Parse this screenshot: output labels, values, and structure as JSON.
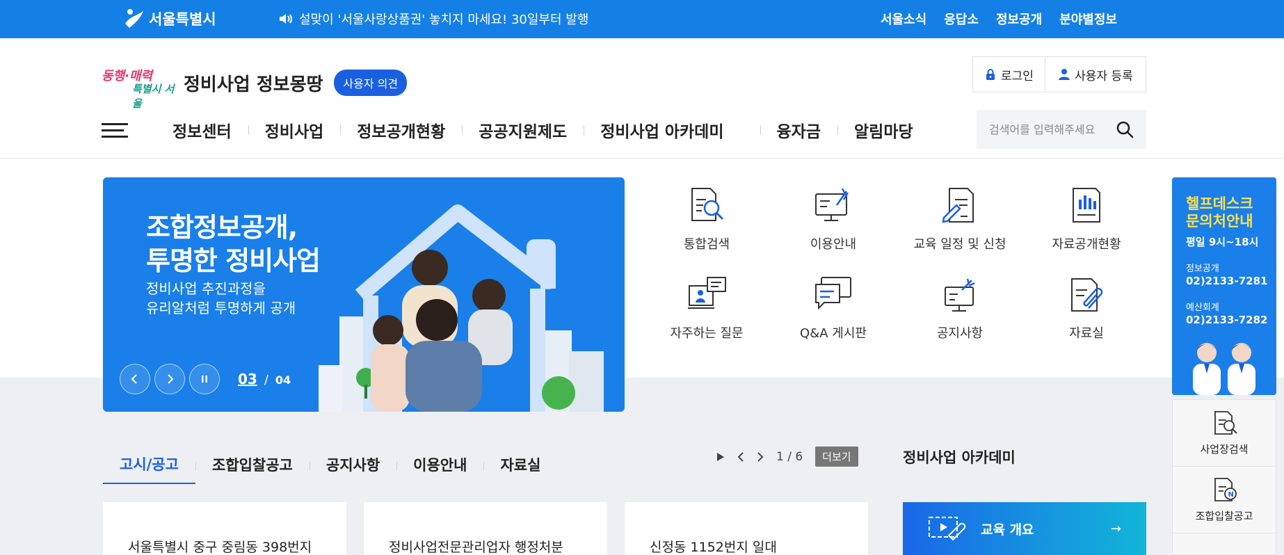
{
  "topbar": {
    "logo_text": "서울특별시",
    "notice": "설맞이 '서울사랑상품권' 놓치지 마세요! 30일부터 발행",
    "links": [
      "서울소식",
      "응답소",
      "정보공개",
      "분야별정보"
    ]
  },
  "header": {
    "brand_slogan_1": "동행·매력",
    "brand_slogan_2": "특별시 서울",
    "site_title": "정비사업 정보몽땅",
    "opinion_label": "사용자 의견",
    "login_label": "로그인",
    "register_label": "사용자 등록",
    "menu": [
      "정보센터",
      "정비사업",
      "정보공개현황",
      "공공지원제도",
      "정비사업 아카데미",
      "융자금",
      "알림마당"
    ],
    "search_placeholder": "검색어를 입력해주세요"
  },
  "banner": {
    "headline_1": "조합정보공개,",
    "headline_2": "투명한 정비사업",
    "sub_1": "정비사업 추진과정을",
    "sub_2": "유리알처럼 투명하게 공개",
    "current": "03",
    "separator": "/",
    "total": "04"
  },
  "quick_links": [
    {
      "label": "통합검색",
      "icon": "search-document-icon"
    },
    {
      "label": "이용안내",
      "icon": "monitor-guide-icon"
    },
    {
      "label": "교육 일정 및 신청",
      "icon": "edit-document-icon"
    },
    {
      "label": "자료공개현황",
      "icon": "chart-document-icon"
    },
    {
      "label": "자주하는 질문",
      "icon": "faq-monitor-icon"
    },
    {
      "label": "Q&A 게시판",
      "icon": "chat-bubbles-icon"
    },
    {
      "label": "공지사항",
      "icon": "announcement-icon"
    },
    {
      "label": "자료실",
      "icon": "attachment-document-icon"
    }
  ],
  "helpdesk": {
    "title_1": "헬프데스크",
    "title_2": "문의처안내",
    "hours": "평일 9시~18시",
    "info_label": "정보공개",
    "info_number": "02)2133-7281",
    "budget_label": "예산회계",
    "budget_number": "02)2133-7282"
  },
  "side_quick": [
    {
      "label": "사업장검색",
      "icon": "site-search-icon"
    },
    {
      "label": "조합입찰공고",
      "icon": "bid-notice-icon"
    }
  ],
  "board": {
    "tabs": [
      "고시/공고",
      "조합입찰공고",
      "공지사항",
      "이용안내",
      "자료실"
    ],
    "page": "1 / 6",
    "more_label": "더보기",
    "cards": [
      "서울특별시 중구 중림동 398번지",
      "정비사업전문관리업자 행정처분",
      "신정동 1152번지 일대"
    ]
  },
  "academy": {
    "title": "정비사업 아카데미",
    "card_label": "교육 개요",
    "arrow": "→"
  },
  "colors": {
    "primary": "#1480e6",
    "accent": "#1a5fe0",
    "helpdesk_title": "#ffe14d"
  }
}
